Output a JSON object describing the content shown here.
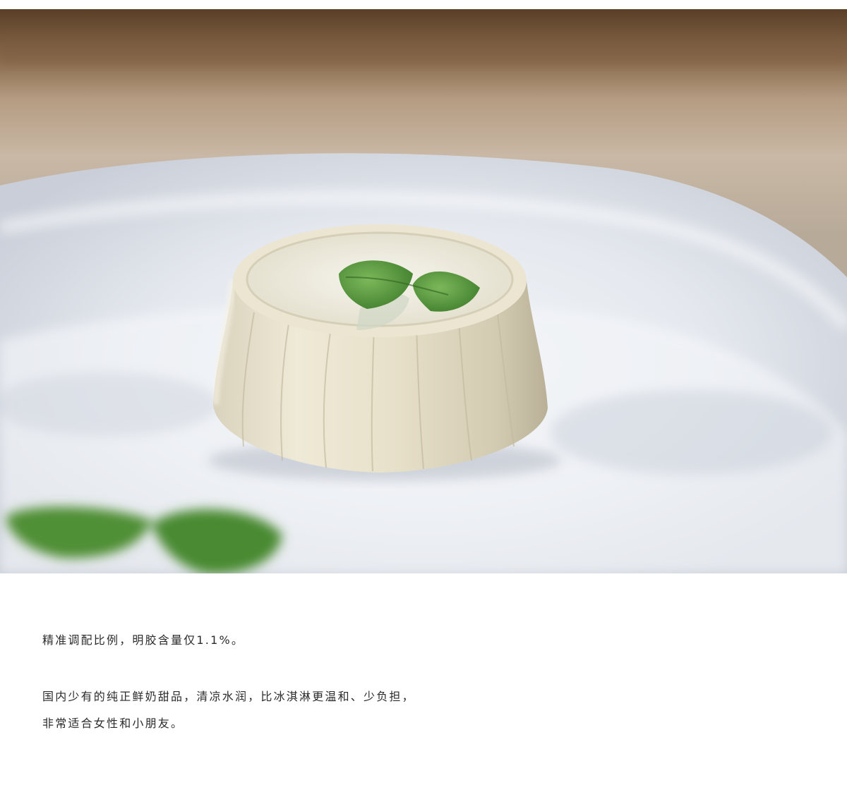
{
  "hero": {
    "subject": "milk-pudding-with-mint-on-white-plate"
  },
  "copy": {
    "line1": "精准调配比例，明胶含量仅1.1%。",
    "line2": "国内少有的纯正鲜奶甜品，清凉水润，比冰淇淋更温和、少负担，",
    "line3": "非常适合女性和小朋友。"
  }
}
